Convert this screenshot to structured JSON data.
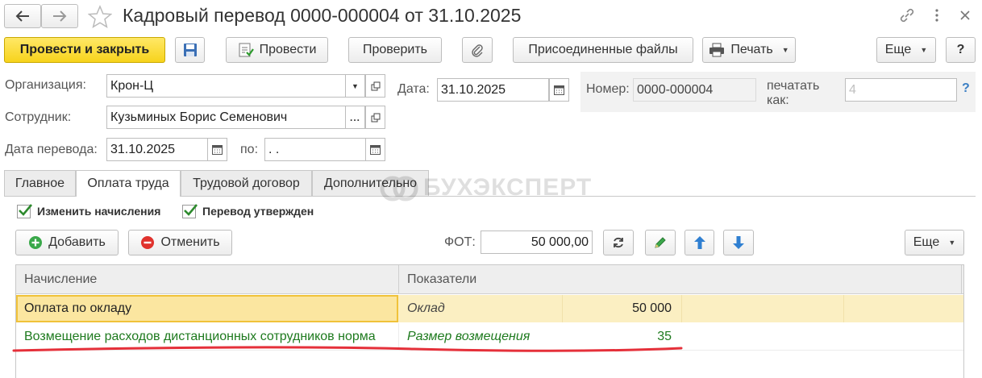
{
  "window": {
    "title": "Кадровый перевод 0000-000004 от 31.10.2025"
  },
  "toolbar": {
    "post_close": "Провести и закрыть",
    "post": "Провести",
    "check": "Проверить",
    "attached_files": "Присоединенные файлы",
    "print": "Печать",
    "more": "Еще",
    "help": "?"
  },
  "form": {
    "organization_label": "Организация:",
    "organization_value": "Крон-Ц",
    "date_label": "Дата:",
    "date_value": "31.10.2025",
    "number_label": "Номер:",
    "number_value": "0000-000004",
    "print_as_label_1": "печатать",
    "print_as_label_2": "как:",
    "print_as_placeholder": "4",
    "print_as_help": "?",
    "employee_label": "Сотрудник:",
    "employee_value": "Кузьминых Борис Семенович",
    "transfer_date_label": "Дата перевода:",
    "transfer_date_value": "31.10.2025",
    "to_label": "по:",
    "to_value": " .  ."
  },
  "tabs": [
    {
      "label": "Главное",
      "active": false
    },
    {
      "label": "Оплата труда",
      "active": true
    },
    {
      "label": "Трудовой договор",
      "active": false
    },
    {
      "label": "Дополнительно",
      "active": false
    }
  ],
  "watermark": "БУХЭКСПЕРТ",
  "options": {
    "change_accruals": "Изменить начисления",
    "change_accruals_checked": true,
    "transfer_approved": "Перевод утвержден",
    "transfer_approved_checked": true
  },
  "grid_toolbar": {
    "add": "Добавить",
    "cancel": "Отменить",
    "fot_label": "ФОТ:",
    "fot_value": "50 000,00",
    "more": "Еще"
  },
  "table": {
    "headers": [
      "Начисление",
      "Показатели"
    ],
    "rows": [
      {
        "accrual": "Оплата по окладу",
        "indicator": "Оклад",
        "value": "50 000"
      },
      {
        "accrual": "Возмещение расходов дистанционных сотрудников норма",
        "indicator": "Размер возмещения",
        "value": "35"
      }
    ]
  },
  "colors": {
    "primary_button": "#f7d31c",
    "selected_row": "#fbefc2",
    "green_text": "#1e7a1e",
    "annotation_line": "#e5303a",
    "blue_icon": "#2f7fd1"
  }
}
